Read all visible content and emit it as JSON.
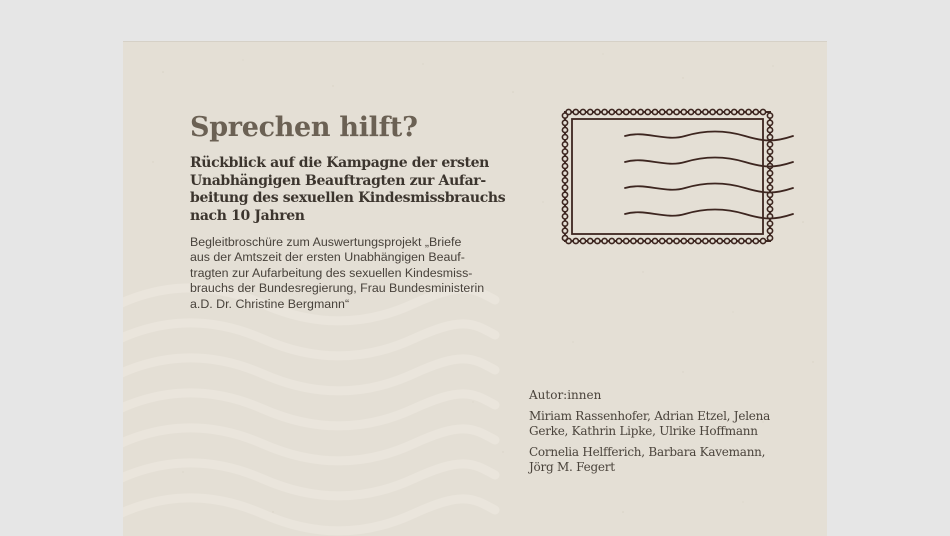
{
  "document": {
    "title": "Sprechen hilft?",
    "subtitle_lines": [
      "Rückblick auf die Kampagne der ersten",
      "Unabhängigen Beauftragten zur Aufar-",
      "beitung des sexuellen Kindesmissbrauchs",
      "nach 10 Jahren"
    ],
    "description_lines": [
      "Begleitbroschüre zum Auswertungsprojekt „Briefe",
      "aus der Amtszeit der ersten Unabhängigen Beauf-",
      "tragten zur Aufarbeitung des sexuellen Kindesmiss-",
      "brauchs der Bundesregierung, Frau Bundesministerin",
      "a.D. Dr. Christine Bergmann“"
    ],
    "authors": {
      "label": "Autor:innen",
      "group1_lines": [
        "Miriam Rassenhofer, Adrian Etzel, Jelena",
        "Gerke, Kathrin Lipke, Ulrike Hoffmann"
      ],
      "group2_lines": [
        "Cornelia Helfferich, Barbara Kavemann,",
        "Jörg M. Fegert"
      ]
    }
  },
  "colors": {
    "page_background": "#e6e6e6",
    "paper": "#e4dfd5",
    "title": "#6b6154",
    "body_text": "#3c352e",
    "stamp_ink": "#3d2620"
  },
  "icons": {
    "stamp": "postage-stamp-icon",
    "postmark": "postmark-waves-icon"
  }
}
